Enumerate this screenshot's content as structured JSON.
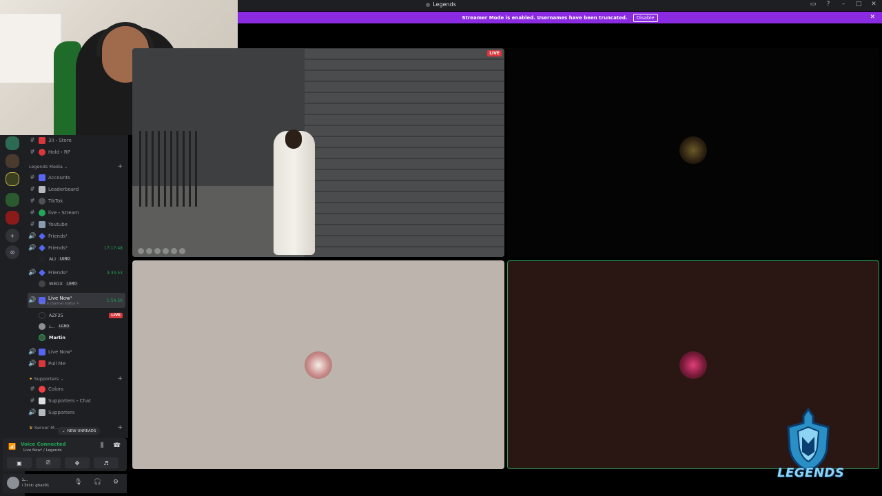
{
  "window": {
    "title": "Legends",
    "controls": [
      "▭",
      "?",
      "–",
      "□",
      "✕"
    ]
  },
  "banner": {
    "text": "Streamer Mode is enabled. Usernames have been truncated.",
    "disable_label": "Disable",
    "close": "✕"
  },
  "rail": {
    "add_server": "+",
    "discover": "⊙"
  },
  "channels": {
    "items": [
      {
        "name": "3li・Store",
        "type": "text",
        "color": "#da373c"
      },
      {
        "name": "Hold・RP",
        "type": "text",
        "color": "#da373c"
      }
    ],
    "legends_media": {
      "label": "Legends Media",
      "items": [
        {
          "name": "Accounts",
          "type": "text"
        },
        {
          "name": "Leaderboard",
          "type": "text"
        },
        {
          "name": "TikTok",
          "type": "text"
        },
        {
          "name": "live・Stream",
          "type": "text"
        },
        {
          "name": "Youtube",
          "type": "text"
        }
      ]
    },
    "voice": [
      {
        "name": "Friends¹"
      },
      {
        "name": "Friends²",
        "time": "17:17:48"
      },
      {
        "name": "Friends³",
        "time": "3:33:53"
      }
    ],
    "friends2_member": {
      "name": "ALI",
      "tag": "LGND"
    },
    "friends3_member": {
      "name": "WEDX",
      "tag": "LGND"
    },
    "live_now1": {
      "name": "Live Now¹",
      "time": "1:54:56",
      "status": "Set a channel status ✎"
    },
    "live_now1_members": [
      {
        "name": "AZF25",
        "live": "LIVE"
      },
      {
        "name": "ג...",
        "tag": "LGND"
      },
      {
        "name": "Martin"
      }
    ],
    "live_now2": {
      "name": "Live Now²"
    },
    "pull_me": {
      "name": "Pull Me"
    },
    "supporters": {
      "label": "Supporters",
      "items": [
        {
          "name": "Colors"
        },
        {
          "name": "Supporters・Chat"
        },
        {
          "name": "Supporters"
        }
      ]
    },
    "server_m": {
      "label": "Server M..."
    }
  },
  "new_unreads": "NEW UNREADS",
  "voice_panel": {
    "title": "Voice Connected",
    "subtitle": "Live Now¹ / Legends"
  },
  "user_panel": {
    "name": "ג...",
    "status": "Ꭵ 3iick: ghaz91"
  },
  "stream": {
    "live_label": "LIVE"
  },
  "branding": {
    "logo_text": "LEGENDS"
  }
}
